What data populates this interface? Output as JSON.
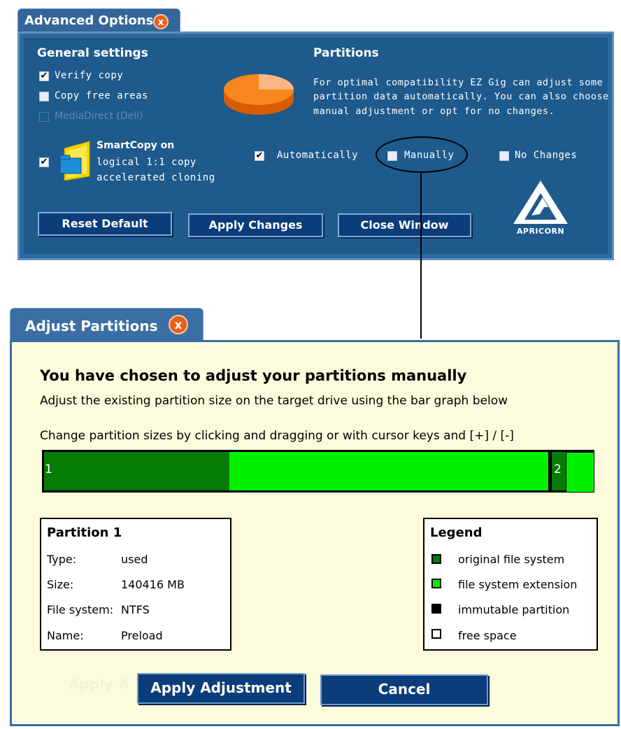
{
  "advanced": {
    "tab_title": "Advanced Options",
    "close_glyph": "x",
    "general_heading": "General settings",
    "verify_copy": "Verify copy",
    "copy_free_areas": "Copy free areas",
    "media_direct": "MediaDirect (Dell)",
    "smartcopy_title": "SmartCopy on",
    "smartcopy_line2": "logical 1:1 copy",
    "smartcopy_line3": "accelerated cloning",
    "partitions_heading": "Partitions",
    "partitions_desc_1": "For optimal compatibility EZ Gig can adjust some",
    "partitions_desc_2": "partition data automatically. You can also choose",
    "partitions_desc_3": "manual adjustment or opt for no changes.",
    "opt_automatically": "Automatically",
    "opt_manually": "Manually",
    "opt_no_changes": "No Changes",
    "btn_reset": "Reset Default",
    "btn_apply": "Apply Changes",
    "btn_close": "Close Window",
    "logo_text": "APRICORN",
    "check_mark": "✔",
    "states": {
      "verify_copy": true,
      "copy_free_areas": false,
      "media_direct": false,
      "smartcopy": true,
      "automatically": true,
      "manually": false,
      "no_changes": false
    }
  },
  "adjust": {
    "tab_title": "Adjust Partitions",
    "close_glyph": "x",
    "heading": "You have chosen to adjust your partitions manually",
    "subheading": "Adjust the existing partition size on the target drive using the bar graph below",
    "instructions": "Change partition sizes by clicking and dragging or with cursor keys and [+] / [-]",
    "partition_labels": [
      "1",
      "2"
    ],
    "partition_info": {
      "title": "Partition 1",
      "type_label": "Type:",
      "type_value": "used",
      "size_label": "Size:",
      "size_value": "140416 MB",
      "fs_label": "File system:",
      "fs_value": "NTFS",
      "name_label": "Name:",
      "name_value": "Preload"
    },
    "legend": {
      "title": "Legend",
      "items": [
        {
          "label": "original file system",
          "color": "#067b06"
        },
        {
          "label": "file system extension",
          "color": "#00f000"
        },
        {
          "label": "immutable partition",
          "color": "#000000"
        },
        {
          "label": "free space",
          "color": "#ffffff"
        }
      ]
    },
    "ghost_text": "Apply A",
    "btn_apply": "Apply Adjustment",
    "btn_cancel": "Cancel"
  }
}
